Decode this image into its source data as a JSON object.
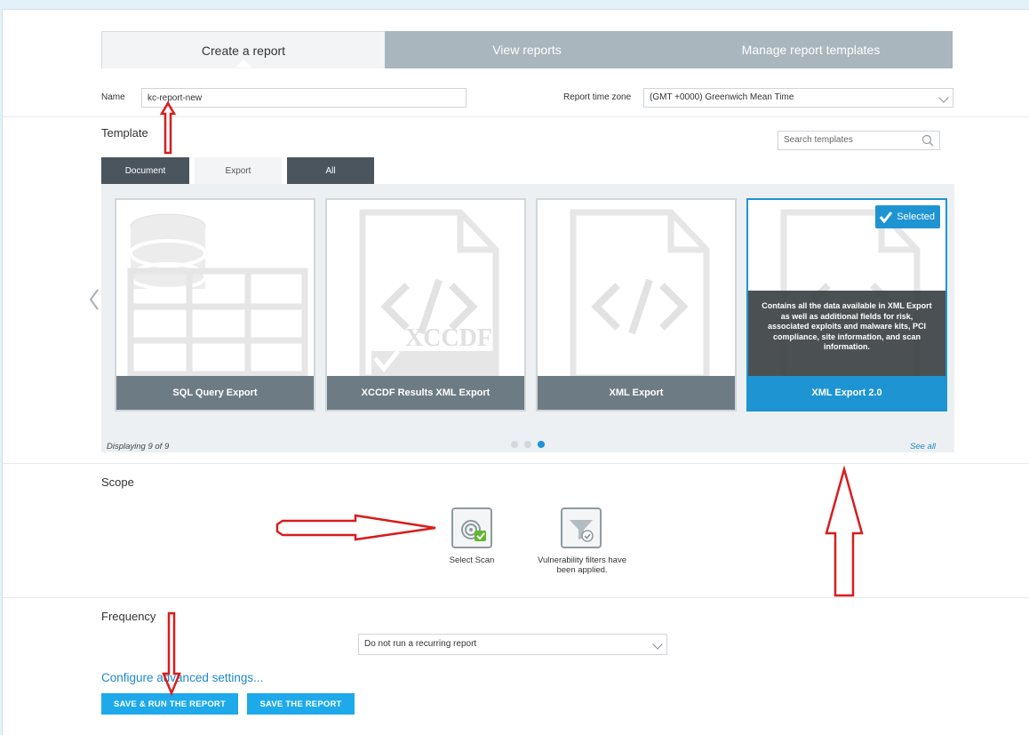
{
  "tabs": [
    {
      "label": "Create a report"
    },
    {
      "label": "View reports"
    },
    {
      "label": "Manage report templates"
    }
  ],
  "name": {
    "label": "Name",
    "value": "kc-report-new"
  },
  "timezone": {
    "label": "Report time zone",
    "value": "(GMT +0000) Greenwich Mean Time"
  },
  "template": {
    "title": "Template",
    "search_placeholder": "Search templates",
    "subtabs": [
      {
        "label": "Document"
      },
      {
        "label": "Export"
      },
      {
        "label": "All"
      }
    ],
    "cards": [
      {
        "label": "SQL Query Export"
      },
      {
        "label": "XCCDF Results XML Export",
        "watermark": "XCCDF"
      },
      {
        "label": "XML Export"
      },
      {
        "label": "XML Export 2.0",
        "badge": "Selected",
        "description": "Contains all the data available in XML Export as well as additional fields for risk, associated exploits and malware kits, PCI compliance, site information, and scan information."
      }
    ],
    "displaying": "Displaying 9 of 9",
    "see_all": "See all",
    "page_current": 3,
    "page_count": 3
  },
  "scope": {
    "title": "Scope",
    "select_scan": "Select Scan",
    "filters_line1": "Vulnerability filters have",
    "filters_line2": "been applied."
  },
  "frequency": {
    "title": "Frequency",
    "value": "Do not run a recurring report"
  },
  "advanced_link": "Configure advanced settings...",
  "buttons": {
    "save_run": "SAVE & RUN THE REPORT",
    "save": "SAVE THE REPORT"
  },
  "colors": {
    "accent": "#1e94d2",
    "button": "#1eaaea",
    "annotation": "#d81d1d"
  }
}
